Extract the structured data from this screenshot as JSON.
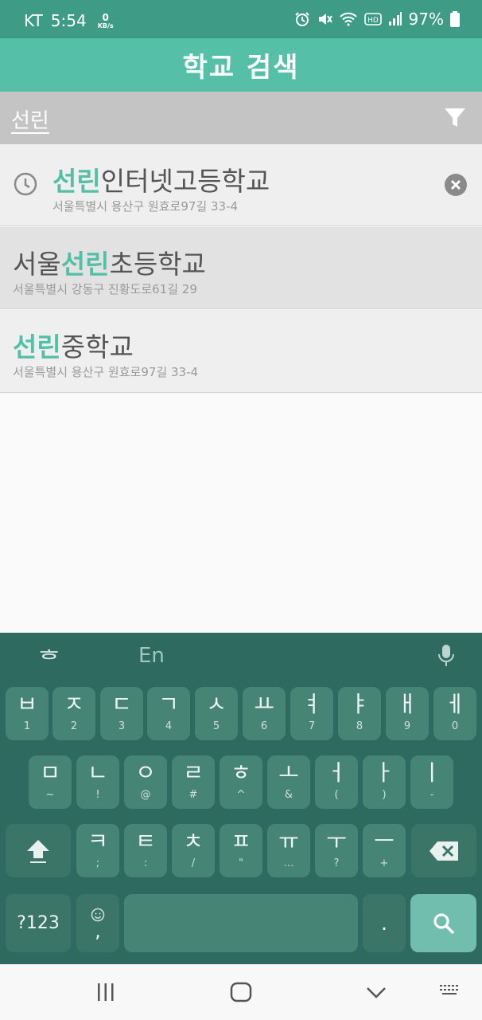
{
  "status_bar": {
    "carrier": "KT",
    "time": "5:54",
    "net_speed_value": "0",
    "net_speed_unit": "KB/s",
    "battery": "97%"
  },
  "app_bar": {
    "title": "학교 검색"
  },
  "search": {
    "value": "선린"
  },
  "results": [
    {
      "prefix": "",
      "highlight": "선린",
      "suffix": "인터넷고등학교",
      "address": "서울특별시 용산구 원효로97길 33-4",
      "recent": true
    },
    {
      "prefix": "서울",
      "highlight": "선린",
      "suffix": "초등학교",
      "address": "서울특별시 강동구 진황도로61길 29",
      "recent": false
    },
    {
      "prefix": "",
      "highlight": "선린",
      "suffix": "중학교",
      "address": "서울특별시 용산구 원효로97길 33-4",
      "recent": false
    }
  ],
  "keyboard": {
    "toolbar": {
      "hangul": "ᄒ",
      "english": "En"
    },
    "row1": [
      {
        "main": "ㅂ",
        "sub": "1"
      },
      {
        "main": "ㅈ",
        "sub": "2"
      },
      {
        "main": "ㄷ",
        "sub": "3"
      },
      {
        "main": "ㄱ",
        "sub": "4"
      },
      {
        "main": "ㅅ",
        "sub": "5"
      },
      {
        "main": "ㅛ",
        "sub": "6"
      },
      {
        "main": "ㅕ",
        "sub": "7"
      },
      {
        "main": "ㅑ",
        "sub": "8"
      },
      {
        "main": "ㅐ",
        "sub": "9"
      },
      {
        "main": "ㅔ",
        "sub": "0"
      }
    ],
    "row2": [
      {
        "main": "ㅁ",
        "sub": "~"
      },
      {
        "main": "ㄴ",
        "sub": "!"
      },
      {
        "main": "ㅇ",
        "sub": "@"
      },
      {
        "main": "ㄹ",
        "sub": "#"
      },
      {
        "main": "ㅎ",
        "sub": "^"
      },
      {
        "main": "ㅗ",
        "sub": "&"
      },
      {
        "main": "ㅓ",
        "sub": "("
      },
      {
        "main": "ㅏ",
        "sub": ")"
      },
      {
        "main": "ㅣ",
        "sub": "-"
      }
    ],
    "row3": [
      {
        "main": "ㅋ",
        "sub": ";"
      },
      {
        "main": "ㅌ",
        "sub": ":"
      },
      {
        "main": "ㅊ",
        "sub": "/"
      },
      {
        "main": "ㅍ",
        "sub": "\""
      },
      {
        "main": "ㅠ",
        "sub": "…"
      },
      {
        "main": "ㅜ",
        "sub": "?"
      },
      {
        "main": "ㅡ",
        "sub": "+"
      }
    ],
    "symbols_label": "?123",
    "comma_label": ",",
    "period_label": "."
  },
  "colors": {
    "accent": "#55bfa7",
    "highlight_text": "#52c0a6",
    "keyboard_bg": "#2e6a5f",
    "key_bg": "#468476"
  }
}
